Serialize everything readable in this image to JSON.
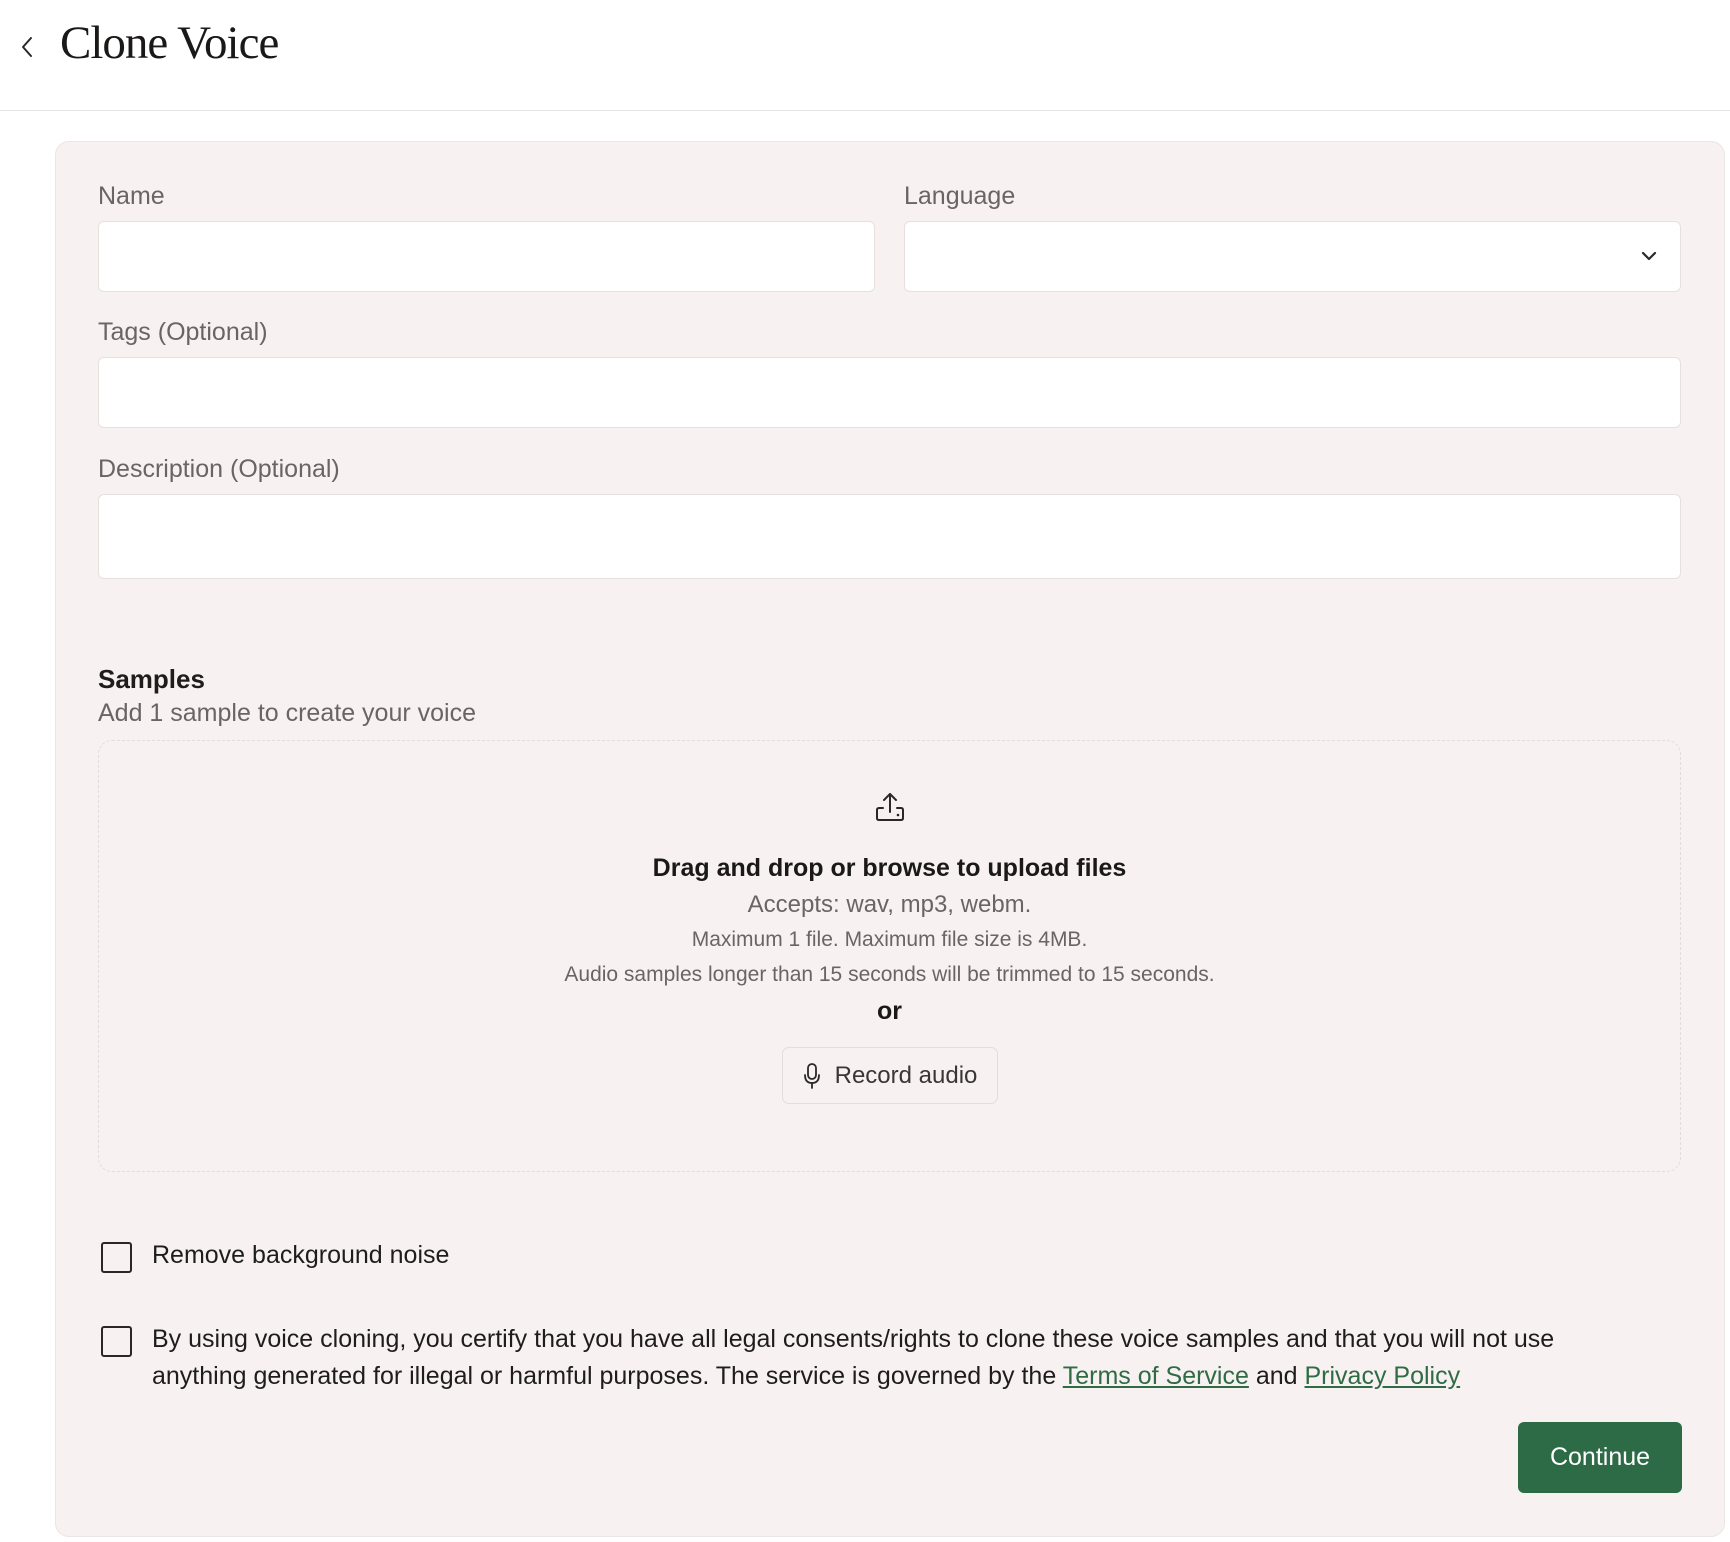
{
  "header": {
    "title": "Clone Voice",
    "back_icon": "chevron-left-icon"
  },
  "form": {
    "name_label": "Name",
    "name_value": "",
    "language_label": "Language",
    "language_value": "",
    "tags_label": "Tags (Optional)",
    "tags_value": "",
    "description_label": "Description (Optional)",
    "description_value": ""
  },
  "samples": {
    "title": "Samples",
    "subtitle": "Add 1 sample to create your voice",
    "upload_icon": "upload-icon",
    "drop_text": "Drag and drop or browse to upload files",
    "accepts": "Accepts: wav, mp3, webm.",
    "max_files": "Maximum 1 file. Maximum file size is 4MB.",
    "trim_note": "Audio samples longer than 15 seconds will be trimmed to 15 seconds.",
    "or_text": "or",
    "record_label": "Record audio",
    "record_icon": "microphone-icon"
  },
  "options": {
    "noise_label": "Remove background noise",
    "noise_checked": false,
    "consent_text_1": "By using voice cloning, you certify that you have all legal consents/rights to clone these voice samples and that you will not use anything generated for illegal or harmful purposes. The service is governed by the ",
    "terms_link": "Terms of Service",
    "consent_and": " and ",
    "privacy_link": "Privacy Policy",
    "consent_checked": false
  },
  "actions": {
    "continue_label": "Continue"
  },
  "colors": {
    "accent": "#2d6b47",
    "card_bg": "#f7f2f1",
    "link": "#2f6b45"
  }
}
